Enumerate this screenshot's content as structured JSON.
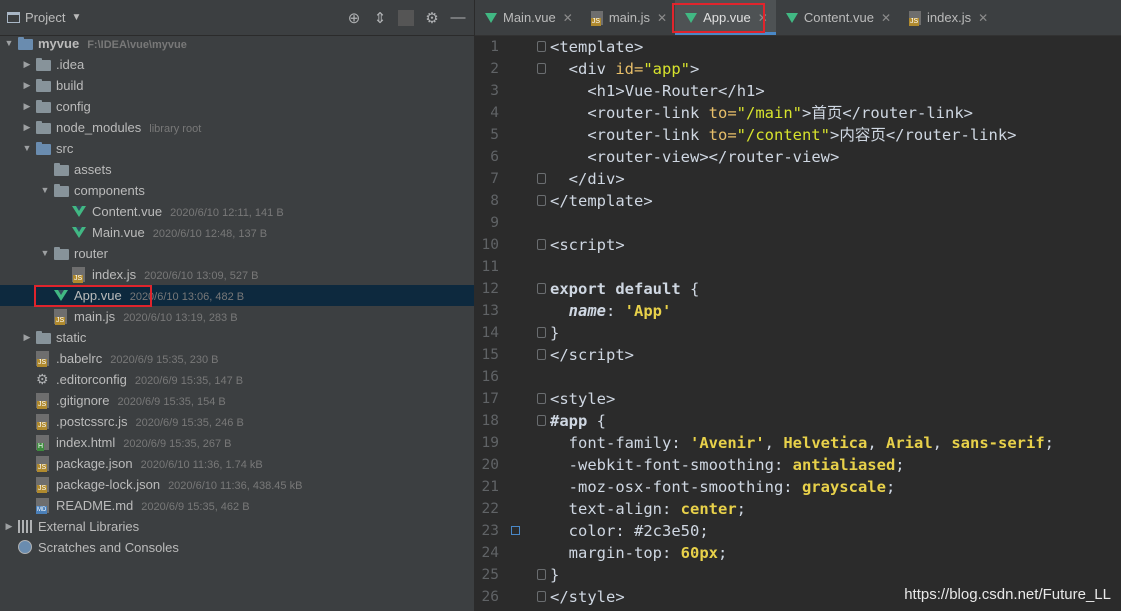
{
  "project_panel": {
    "title": "Project",
    "tools": [
      "target-icon",
      "collapse-icon",
      "gear-icon",
      "minimize-icon"
    ]
  },
  "tree": [
    {
      "indent": 0,
      "arrow": "▼",
      "icon": "folder-blue",
      "name": "myvue",
      "meta": "F:\\IDEA\\vue\\myvue",
      "bold": true
    },
    {
      "indent": 1,
      "arrow": "▶",
      "icon": "folder",
      "name": ".idea",
      "meta": ""
    },
    {
      "indent": 1,
      "arrow": "▶",
      "icon": "folder",
      "name": "build",
      "meta": ""
    },
    {
      "indent": 1,
      "arrow": "▶",
      "icon": "folder",
      "name": "config",
      "meta": ""
    },
    {
      "indent": 1,
      "arrow": "▶",
      "icon": "folder",
      "name": "node_modules",
      "meta": "library root"
    },
    {
      "indent": 1,
      "arrow": "▼",
      "icon": "folder-blue",
      "name": "src",
      "meta": ""
    },
    {
      "indent": 2,
      "arrow": "",
      "icon": "folder",
      "name": "assets",
      "meta": ""
    },
    {
      "indent": 2,
      "arrow": "▼",
      "icon": "folder",
      "name": "components",
      "meta": ""
    },
    {
      "indent": 3,
      "arrow": "",
      "icon": "vue",
      "name": "Content.vue",
      "meta": "2020/6/10 12:11, 141 B"
    },
    {
      "indent": 3,
      "arrow": "",
      "icon": "vue",
      "name": "Main.vue",
      "meta": "2020/6/10 12:48, 137 B"
    },
    {
      "indent": 2,
      "arrow": "▼",
      "icon": "folder",
      "name": "router",
      "meta": ""
    },
    {
      "indent": 3,
      "arrow": "",
      "icon": "js",
      "name": "index.js",
      "meta": "2020/6/10 13:09, 527 B"
    },
    {
      "indent": 2,
      "arrow": "",
      "icon": "vue",
      "name": "App.vue",
      "meta": "2020/6/10 13:06, 482 B",
      "selected": true
    },
    {
      "indent": 2,
      "arrow": "",
      "icon": "js",
      "name": "main.js",
      "meta": "2020/6/10 13:19, 283 B"
    },
    {
      "indent": 1,
      "arrow": "▶",
      "icon": "folder",
      "name": "static",
      "meta": ""
    },
    {
      "indent": 1,
      "arrow": "",
      "icon": "js",
      "name": ".babelrc",
      "meta": "2020/6/9 15:35, 230 B"
    },
    {
      "indent": 1,
      "arrow": "",
      "icon": "gear",
      "name": ".editorconfig",
      "meta": "2020/6/9 15:35, 147 B"
    },
    {
      "indent": 1,
      "arrow": "",
      "icon": "js",
      "name": ".gitignore",
      "meta": "2020/6/9 15:35, 154 B"
    },
    {
      "indent": 1,
      "arrow": "",
      "icon": "js",
      "name": ".postcssrc.js",
      "meta": "2020/6/9 15:35, 246 B"
    },
    {
      "indent": 1,
      "arrow": "",
      "icon": "html",
      "name": "index.html",
      "meta": "2020/6/9 15:35, 267 B"
    },
    {
      "indent": 1,
      "arrow": "",
      "icon": "js",
      "name": "package.json",
      "meta": "2020/6/10 11:36, 1.74 kB"
    },
    {
      "indent": 1,
      "arrow": "",
      "icon": "js",
      "name": "package-lock.json",
      "meta": "2020/6/10 11:36, 438.45 kB"
    },
    {
      "indent": 1,
      "arrow": "",
      "icon": "md",
      "name": "README.md",
      "meta": "2020/6/9 15:35, 462 B"
    },
    {
      "indent": 0,
      "arrow": "▶",
      "icon": "lib",
      "name": "External Libraries",
      "meta": ""
    },
    {
      "indent": 0,
      "arrow": "",
      "icon": "scratch",
      "name": "Scratches and Consoles",
      "meta": ""
    }
  ],
  "tabs": [
    {
      "label": "Main.vue",
      "icon": "vue",
      "active": false
    },
    {
      "label": "main.js",
      "icon": "js",
      "active": false
    },
    {
      "label": "App.vue",
      "icon": "vue",
      "active": true
    },
    {
      "label": "Content.vue",
      "icon": "vue",
      "active": false
    },
    {
      "label": "index.js",
      "icon": "js",
      "active": false
    }
  ],
  "code_lines": [
    {
      "n": 1,
      "fold": true,
      "t": [
        [
          "<",
          "s-lt"
        ],
        [
          "template",
          "s-tag"
        ],
        [
          ">",
          "s-lt"
        ]
      ]
    },
    {
      "n": 2,
      "fold": true,
      "t": [
        [
          "  <",
          "s-lt"
        ],
        [
          "div ",
          "s-tag"
        ],
        [
          "id=",
          "s-key"
        ],
        [
          "\"app\"",
          "s-attrv"
        ],
        [
          ">",
          "s-lt"
        ]
      ]
    },
    {
      "n": 3,
      "t": [
        [
          "    <",
          "s-lt"
        ],
        [
          "h1",
          "s-tag"
        ],
        [
          ">",
          "s-lt"
        ],
        [
          "Vue-Router",
          "s-plain"
        ],
        [
          "</",
          "s-lt"
        ],
        [
          "h1",
          "s-tag"
        ],
        [
          ">",
          "s-lt"
        ]
      ]
    },
    {
      "n": 4,
      "t": [
        [
          "    <",
          "s-lt"
        ],
        [
          "router-link ",
          "s-tag"
        ],
        [
          "to=",
          "s-key"
        ],
        [
          "\"/main\"",
          "s-attrv"
        ],
        [
          ">",
          "s-lt"
        ],
        [
          "首页",
          "s-cjk"
        ],
        [
          "</",
          "s-lt"
        ],
        [
          "router-link",
          "s-tag"
        ],
        [
          ">",
          "s-lt"
        ]
      ]
    },
    {
      "n": 5,
      "t": [
        [
          "    <",
          "s-lt"
        ],
        [
          "router-link ",
          "s-tag"
        ],
        [
          "to=",
          "s-key"
        ],
        [
          "\"/content\"",
          "s-attrv"
        ],
        [
          ">",
          "s-lt"
        ],
        [
          "内容页",
          "s-cjk"
        ],
        [
          "</",
          "s-lt"
        ],
        [
          "router-link",
          "s-tag"
        ],
        [
          ">",
          "s-lt"
        ]
      ]
    },
    {
      "n": 6,
      "t": [
        [
          "    <",
          "s-lt"
        ],
        [
          "router-view",
          "s-tag"
        ],
        [
          "></",
          "s-lt"
        ],
        [
          "router-view",
          "s-tag"
        ],
        [
          ">",
          "s-lt"
        ]
      ]
    },
    {
      "n": 7,
      "fold": true,
      "t": [
        [
          "  </",
          "s-lt"
        ],
        [
          "div",
          "s-tag"
        ],
        [
          ">",
          "s-lt"
        ]
      ]
    },
    {
      "n": 8,
      "fold": true,
      "t": [
        [
          "</",
          "s-lt"
        ],
        [
          "template",
          "s-tag"
        ],
        [
          ">",
          "s-lt"
        ]
      ]
    },
    {
      "n": 9,
      "t": []
    },
    {
      "n": 10,
      "fold": true,
      "t": [
        [
          "<",
          "s-lt"
        ],
        [
          "script",
          "s-tag"
        ],
        [
          ">",
          "s-lt"
        ]
      ]
    },
    {
      "n": 11,
      "t": []
    },
    {
      "n": 12,
      "fold": true,
      "t": [
        [
          "export default ",
          "s-kw"
        ],
        [
          "{",
          "s-plain"
        ]
      ]
    },
    {
      "n": 13,
      "t": [
        [
          "  name",
          "s-name"
        ],
        [
          ": ",
          "s-plain"
        ],
        [
          "'App'",
          "s-sq"
        ]
      ]
    },
    {
      "n": 14,
      "fold": true,
      "t": [
        [
          "}",
          "s-plain"
        ]
      ]
    },
    {
      "n": 15,
      "fold": true,
      "t": [
        [
          "</",
          "s-lt"
        ],
        [
          "script",
          "s-tag"
        ],
        [
          ">",
          "s-lt"
        ]
      ]
    },
    {
      "n": 16,
      "t": []
    },
    {
      "n": 17,
      "fold": true,
      "t": [
        [
          "<",
          "s-lt"
        ],
        [
          "style",
          "s-tag"
        ],
        [
          ">",
          "s-lt"
        ]
      ]
    },
    {
      "n": 18,
      "fold": true,
      "t": [
        [
          "#app ",
          "s-hash"
        ],
        [
          "{",
          "s-plain"
        ]
      ]
    },
    {
      "n": 19,
      "t": [
        [
          "  font-family",
          "s-prop"
        ],
        [
          ": ",
          "s-plain"
        ],
        [
          "'Avenir'",
          "s-sq"
        ],
        [
          ", ",
          "s-plain"
        ],
        [
          "Helvetica",
          "s-val"
        ],
        [
          ", ",
          "s-plain"
        ],
        [
          "Arial",
          "s-val"
        ],
        [
          ", ",
          "s-plain"
        ],
        [
          "sans-serif",
          "s-val"
        ],
        [
          ";",
          "s-plain"
        ]
      ]
    },
    {
      "n": 20,
      "t": [
        [
          "  -webkit-font-smoothing",
          "s-prop"
        ],
        [
          ": ",
          "s-plain"
        ],
        [
          "antialiased",
          "s-val"
        ],
        [
          ";",
          "s-plain"
        ]
      ]
    },
    {
      "n": 21,
      "t": [
        [
          "  -moz-osx-font-smoothing",
          "s-prop"
        ],
        [
          ": ",
          "s-plain"
        ],
        [
          "grayscale",
          "s-val"
        ],
        [
          ";",
          "s-plain"
        ]
      ]
    },
    {
      "n": 22,
      "t": [
        [
          "  text-align",
          "s-prop"
        ],
        [
          ": ",
          "s-plain"
        ],
        [
          "center",
          "s-val"
        ],
        [
          ";",
          "s-plain"
        ]
      ]
    },
    {
      "n": 23,
      "bookmark": true,
      "t": [
        [
          "  color",
          "s-prop"
        ],
        [
          ": ",
          "s-plain"
        ],
        [
          "#2c3e50",
          "s-hex"
        ],
        [
          ";",
          "s-plain"
        ]
      ]
    },
    {
      "n": 24,
      "t": [
        [
          "  margin-top",
          "s-prop"
        ],
        [
          ": ",
          "s-plain"
        ],
        [
          "60",
          "s-num"
        ],
        [
          "px",
          "s-val"
        ],
        [
          ";",
          "s-plain"
        ]
      ]
    },
    {
      "n": 25,
      "fold": true,
      "t": [
        [
          "}",
          "s-plain"
        ]
      ]
    },
    {
      "n": 26,
      "fold": true,
      "t": [
        [
          "</",
          "s-lt"
        ],
        [
          "style",
          "s-tag"
        ],
        [
          ">",
          "s-lt"
        ]
      ]
    }
  ],
  "watermark": "https://blog.csdn.net/Future_LL",
  "colors": {
    "selection": "#0d293e",
    "highlight_box": "#e0242c",
    "active_tab_underline": "#4a88c7"
  }
}
